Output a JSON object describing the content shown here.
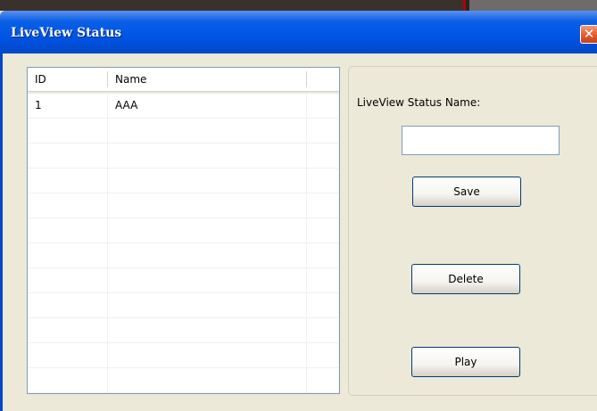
{
  "window": {
    "title": "LiveView Status",
    "close_glyph": "✕"
  },
  "list": {
    "columns": [
      "ID",
      "Name",
      ""
    ],
    "rows": [
      {
        "id": "1",
        "name": "AAA"
      },
      {
        "id": "",
        "name": ""
      },
      {
        "id": "",
        "name": ""
      },
      {
        "id": "",
        "name": ""
      },
      {
        "id": "",
        "name": ""
      },
      {
        "id": "",
        "name": ""
      },
      {
        "id": "",
        "name": ""
      },
      {
        "id": "",
        "name": ""
      },
      {
        "id": "",
        "name": ""
      },
      {
        "id": "",
        "name": ""
      },
      {
        "id": "",
        "name": ""
      },
      {
        "id": "",
        "name": ""
      }
    ]
  },
  "form": {
    "name_label": "LiveView Status Name:",
    "name_value": "",
    "save_label": "Save",
    "delete_label": "Delete",
    "play_label": "Play"
  },
  "colors": {
    "titlebar": "#0055e5",
    "window_face": "#ece9d8",
    "close_button": "#e35b2b"
  }
}
